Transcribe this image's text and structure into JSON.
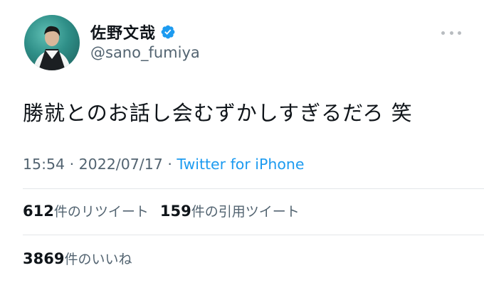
{
  "author": {
    "display_name": "佐野文哉",
    "handle": "@sano_fumiya",
    "verified": true,
    "avatar_icon": "profile-photo"
  },
  "tweet": {
    "text": "勝就とのお話し会むずかしすぎるだろ 笑",
    "time": "15:54",
    "separator": " · ",
    "date": "2022/07/17",
    "source": "Twitter for iPhone"
  },
  "stats": {
    "retweets_count": "612",
    "retweets_label": "件のリツイート",
    "quotes_count": "159",
    "quotes_label": "件の引用ツイート",
    "likes_count": "3869",
    "likes_label": "件のいいね"
  },
  "colors": {
    "link": "#1d9bf0",
    "secondary_text": "#536471",
    "verified_badge": "#1d9bf0"
  }
}
